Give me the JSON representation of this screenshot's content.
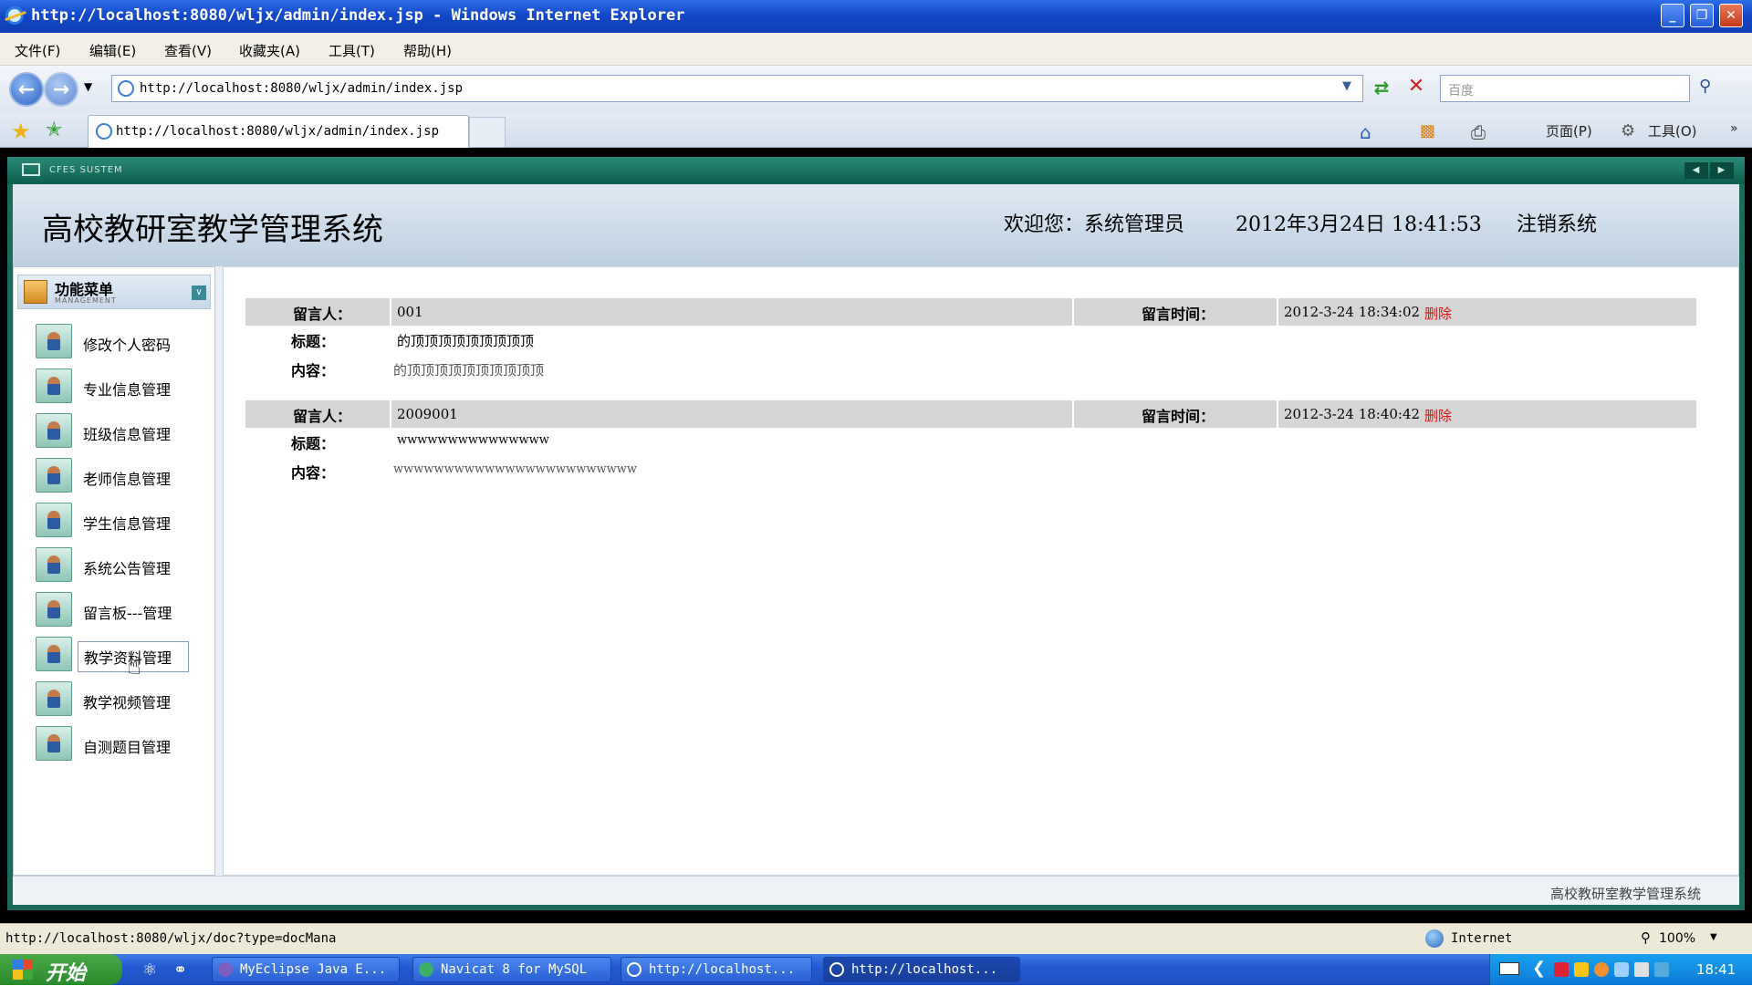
{
  "window": {
    "title": "http://localhost:8080/wljx/admin/index.jsp - Windows Internet Explorer",
    "controls": [
      "_",
      "❐",
      "✕"
    ]
  },
  "menubar": [
    "文件(F)",
    "编辑(E)",
    "查看(V)",
    "收藏夹(A)",
    "工具(T)",
    "帮助(H)"
  ],
  "address": {
    "url": "http://localhost:8080/wljx/admin/index.jsp",
    "search_placeholder": "百度"
  },
  "tab": {
    "label": "http://localhost:8080/wljx/admin/index.jsp"
  },
  "toolbar": {
    "page_label": "页面(P)",
    "tools_label": "工具(O)"
  },
  "app": {
    "system_tag": "CFES SUSTEM",
    "title": "高校教研室教学管理系统",
    "welcome": "欢迎您：系统管理员",
    "datetime": "2012年3月24日  18:41:53",
    "logout": "注销系统",
    "footer": "高校教研室教学管理系统"
  },
  "sidebar": {
    "header": "功能菜单",
    "subheader": "MANAGEMENT",
    "items": [
      "修改个人密码",
      "专业信息管理",
      "班级信息管理",
      "老师信息管理",
      "学生信息管理",
      "系统公告管理",
      "留言板---管理",
      "教学资料管理",
      "教学视频管理",
      "自测题目管理"
    ]
  },
  "messages": {
    "label_author": "留言人：",
    "label_time": "留言时间：",
    "label_title": "标题：",
    "label_content": "内容：",
    "delete_label": "删除",
    "items": [
      {
        "author": "001",
        "time": "2012-3-24 18:34:02",
        "title": "的顶顶顶顶顶顶顶顶顶",
        "content": "的顶顶顶顶顶顶顶顶顶顶"
      },
      {
        "author": "2009001",
        "time": "2012-3-24 18:40:42",
        "title": "wwwwwwwwwwwwwww",
        "content": "wwwwwwwwwwwwwwwwwwwwwwww"
      }
    ]
  },
  "statusbar": {
    "link": "http://localhost:8080/wljx/doc?type=docMana",
    "zone": "Internet",
    "zoom": "100%"
  },
  "taskbar": {
    "start": "开始",
    "tasks": [
      "MyEclipse Java E...",
      "Navicat 8 for MySQL",
      "http://localhost...",
      "http://localhost..."
    ],
    "clock": "18:41"
  }
}
